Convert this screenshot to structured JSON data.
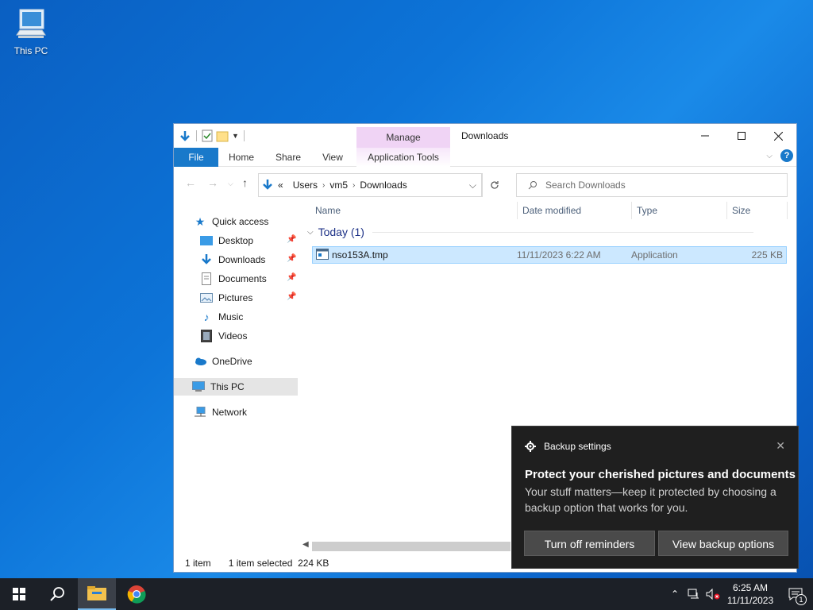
{
  "desktop": {
    "icon_label": "This PC"
  },
  "window": {
    "title": "Downloads",
    "contextual_tab_group": "Manage",
    "ribbon_tabs": [
      "File",
      "Home",
      "Share",
      "View",
      "Application Tools"
    ],
    "address": {
      "prefix": "«",
      "crumbs": [
        "Users",
        "vm5",
        "Downloads"
      ]
    },
    "search_placeholder": "Search Downloads",
    "nav": {
      "quick_access": "Quick access",
      "items": [
        "Desktop",
        "Downloads",
        "Documents",
        "Pictures",
        "Music",
        "Videos"
      ],
      "onedrive": "OneDrive",
      "this_pc": "This PC",
      "network": "Network"
    },
    "columns": {
      "name": "Name",
      "date": "Date modified",
      "type": "Type",
      "size": "Size"
    },
    "group_label": "Today (1)",
    "file": {
      "name": "nso153A.tmp",
      "date": "11/11/2023 6:22 AM",
      "type": "Application",
      "size": "225 KB"
    },
    "status": {
      "count": "1 item",
      "selected": "1 item selected  224 KB"
    }
  },
  "toast": {
    "app": "Backup settings",
    "headline": "Protect your cherished pictures and documents",
    "body": "Your stuff matters—keep it protected by choosing a backup option that works for you.",
    "btn_off": "Turn off reminders",
    "btn_view": "View backup options"
  },
  "taskbar": {
    "time": "6:25 AM",
    "date": "11/11/2023",
    "notification_count": "1"
  },
  "colors": {
    "accent": "#1979ca",
    "selection": "#cce8ff",
    "taskbar": "#1c2027",
    "toast_bg": "#1f1f1f"
  }
}
